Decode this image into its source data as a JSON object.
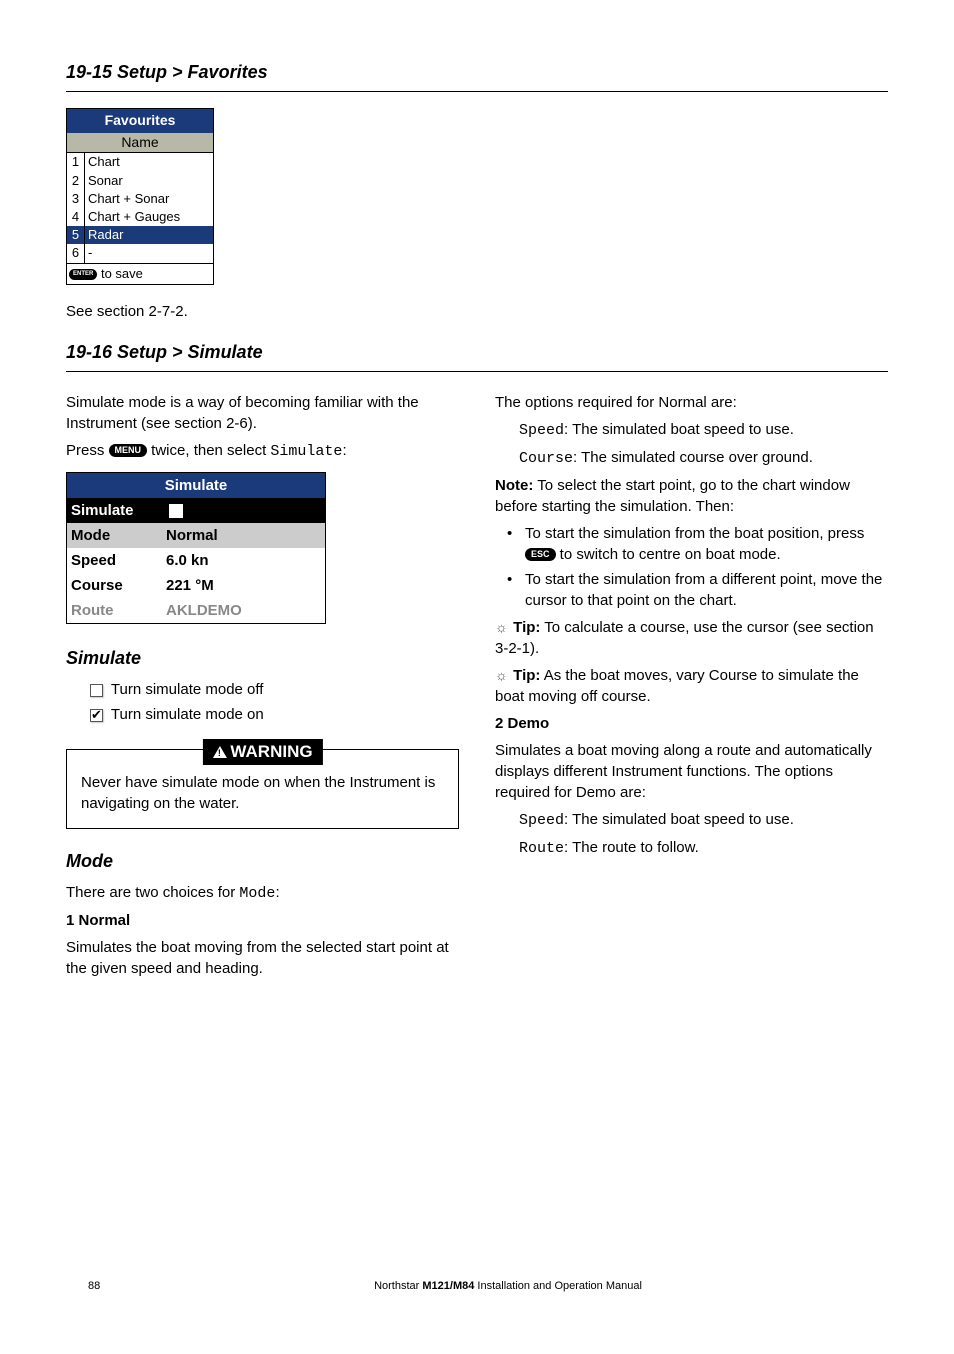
{
  "section1": {
    "title": "19-15 Setup > Favorites",
    "see": "See section 2-7-2."
  },
  "favourites": {
    "header": "Favourites",
    "name_label": "Name",
    "rows": [
      "Chart",
      "Sonar",
      "Chart + Sonar",
      "Chart + Gauges",
      "Radar",
      "-"
    ],
    "save": " to save"
  },
  "section2": {
    "title": "19-16 Setup  > Simulate"
  },
  "left": {
    "intro": "Simulate mode is a way of becoming familiar with the Instrument (see section 2-6).",
    "press1": "Press ",
    "press2": " twice, then select ",
    "press3": "Simulate",
    "press4": ":",
    "menu_key": "MENU"
  },
  "sim_widget": {
    "title": "Simulate",
    "rows": [
      {
        "label": "Simulate",
        "value": ""
      },
      {
        "label": "Mode",
        "value": "Normal"
      },
      {
        "label": "Speed",
        "value": "6.0 kn"
      },
      {
        "label": "Course",
        "value": "221 °M"
      },
      {
        "label": "Route",
        "value": "AKLDEMO"
      }
    ]
  },
  "simulate_sub": {
    "head": "Simulate",
    "off": " Turn simulate mode off",
    "on": " Turn simulate mode on"
  },
  "warning": {
    "label": "WARNING",
    "text": "Never have simulate mode on when the Instrument is navigating on the water."
  },
  "mode": {
    "head": "Mode",
    "intro1": "There are two choices for ",
    "intro2": "Mode",
    "intro3": ":",
    "h1": "1 Normal",
    "p1": "Simulates the boat moving from the selected start point at the given speed and heading. "
  },
  "right": {
    "opts": "The options required for Normal are:",
    "speed_l": "Speed",
    "speed_t": ": The simulated boat speed to use.",
    "course_l": "Course",
    "course_t": ": The simulated course over ground.",
    "note_l": "Note:",
    "note_t": " To select the start point, go to the chart window before starting the simulation. Then:",
    "b1a": "To start the simulation from the boat position, press ",
    "b1_key": "ESC",
    "b1b": " to switch to centre on boat mode.",
    "b2": "To start the simulation from a different point, move the cursor to that point on the chart.",
    "tip_l": "Tip:",
    "tip1": " To calculate a course, use the cursor (see section 3-2-1).",
    "tip2": " As the boat moves, vary Course to simulate the boat moving off course.",
    "h2": "2 Demo",
    "p2": "Simulates a boat moving along a route and automatically displays different Instrument functions. The options required for Demo are:",
    "route_l": "Route",
    "route_t": ": The route to follow."
  },
  "footer": {
    "page": "88",
    "text1": "Northstar ",
    "text2": "M121/M84",
    "text3": "  Installation and Operation Manual"
  }
}
